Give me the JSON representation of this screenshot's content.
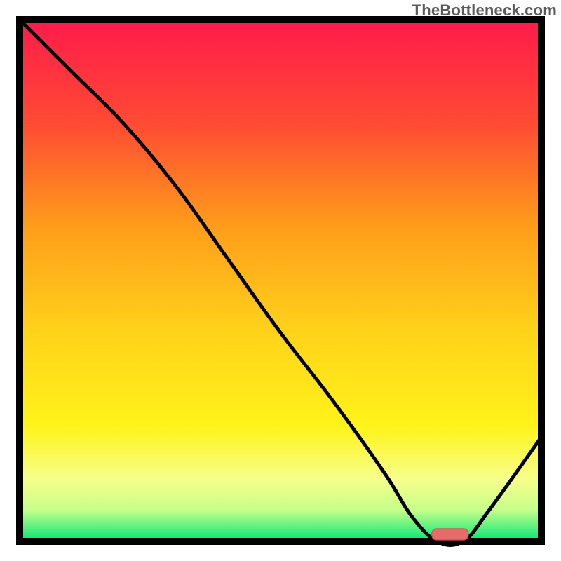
{
  "watermark": "TheBottleneck.com",
  "chart_data": {
    "type": "line",
    "title": "",
    "xlabel": "",
    "ylabel": "",
    "xlim": [
      0,
      100
    ],
    "ylim": [
      0,
      100
    ],
    "x": [
      0,
      10,
      20,
      30,
      40,
      50,
      60,
      70,
      75,
      80,
      85,
      90,
      100
    ],
    "values": [
      100,
      90,
      80,
      68,
      54,
      40,
      27,
      13,
      5,
      0,
      0,
      6,
      20
    ],
    "marker": {
      "x_start": 79,
      "x_end": 86,
      "y": 0
    },
    "colors": {
      "gradient_stops": [
        {
          "offset": 0.0,
          "color": "#ff1a4b"
        },
        {
          "offset": 0.2,
          "color": "#ff4b33"
        },
        {
          "offset": 0.4,
          "color": "#ff9e1a"
        },
        {
          "offset": 0.6,
          "color": "#ffd31a"
        },
        {
          "offset": 0.78,
          "color": "#fff31a"
        },
        {
          "offset": 0.88,
          "color": "#f6ff8a"
        },
        {
          "offset": 0.94,
          "color": "#c6ff8a"
        },
        {
          "offset": 1.0,
          "color": "#00e676"
        }
      ],
      "border": "#000000",
      "curve": "#000000",
      "marker_fill": "#e86b6b",
      "marker_stroke": "#d94a4a"
    },
    "legend": null,
    "grid": false
  }
}
